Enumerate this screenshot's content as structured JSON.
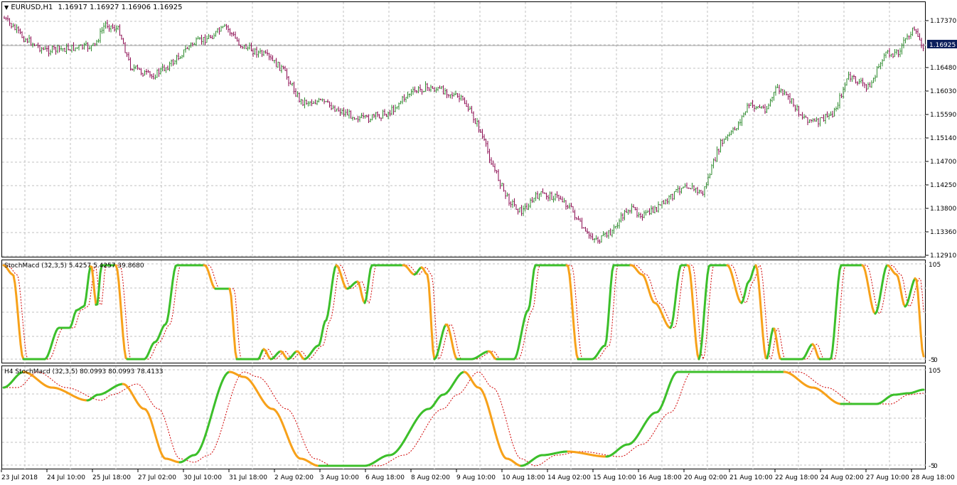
{
  "main_chart": {
    "title": "EURUSD,H1",
    "ohlc": "1.16917 1.16927 1.16906 1.16925",
    "price_levels": [
      "1.17370",
      "1.16925",
      "1.16480",
      "1.16030",
      "1.15590",
      "1.15140",
      "1.14700",
      "1.14250",
      "1.13800",
      "1.13360",
      "1.12910"
    ],
    "current_price": "1.16925",
    "bull_color": "#2e8b2e",
    "bear_color": "#8b0a50"
  },
  "stoch_panel_1": {
    "title": "StochMacd (32,3,5) 5.4257 5.4257 39.8680",
    "level_top": "105",
    "level_bottom": "-5",
    "bottom_tick": "0"
  },
  "stoch_panel_2": {
    "title": "H4 StochMacd (32,3,5) 80.0993 80.0993 78.4133",
    "level_top": "105",
    "level_bottom": "-5",
    "bottom_tick": "0"
  },
  "time_axis": [
    "23 Jul 2018",
    "24 Jul 10:00",
    "25 Jul 18:00",
    "27 Jul 02:00",
    "30 Jul 10:00",
    "31 Jul 18:00",
    "2 Aug 02:00",
    "3 Aug 10:00",
    "6 Aug 18:00",
    "8 Aug 02:00",
    "9 Aug 10:00",
    "10 Aug 18:00",
    "14 Aug 02:00",
    "15 Aug 10:00",
    "16 Aug 18:00",
    "20 Aug 02:00",
    "21 Aug 10:00",
    "22 Aug 18:00",
    "24 Aug 02:00",
    "27 Aug 10:00",
    "28 Aug 18:00"
  ],
  "colors": {
    "up_line": "#3cbf2a",
    "down_line": "#f7a11a",
    "signal_line": "#d10000",
    "grid": "#c0c0c0",
    "price_tag_bg": "#0b1f5c"
  }
}
